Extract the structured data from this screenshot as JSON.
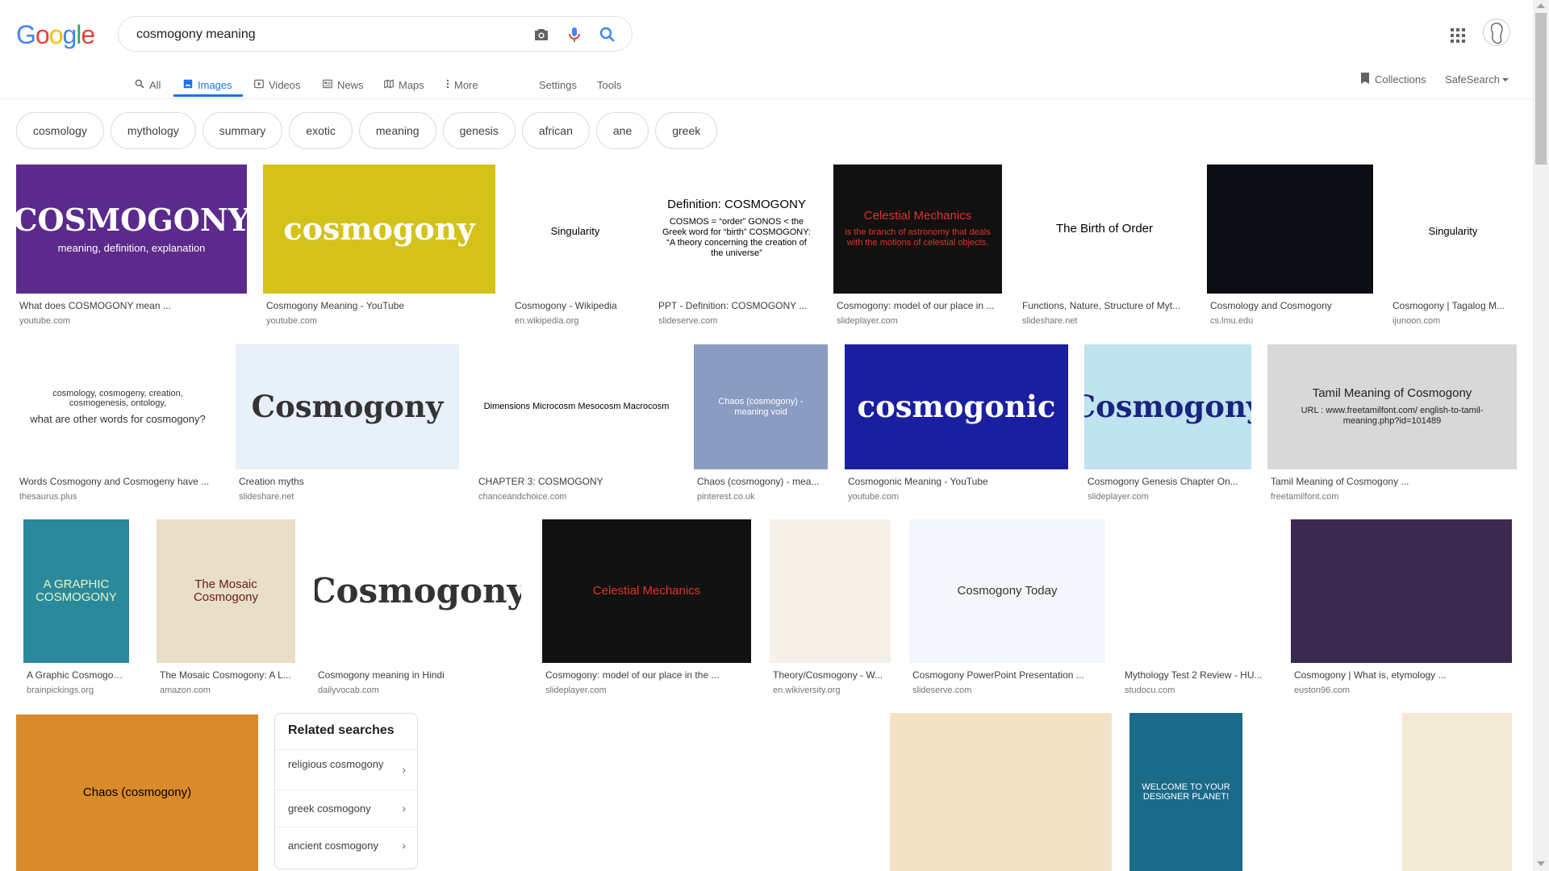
{
  "logo": {
    "letters": [
      "G",
      "o",
      "o",
      "g",
      "l",
      "e"
    ],
    "colors": [
      "#4285F4",
      "#EA4335",
      "#FBBC05",
      "#4285F4",
      "#34A853",
      "#EA4335"
    ]
  },
  "search": {
    "query": "cosmogony meaning"
  },
  "tabs": [
    {
      "label": "All",
      "icon": "search-icon"
    },
    {
      "label": "Images",
      "icon": "image-icon",
      "active": true
    },
    {
      "label": "Videos",
      "icon": "video-icon"
    },
    {
      "label": "News",
      "icon": "news-icon"
    },
    {
      "label": "Maps",
      "icon": "map-icon"
    },
    {
      "label": "More",
      "icon": "more-vert-icon"
    },
    {
      "label": "Settings"
    },
    {
      "label": "Tools"
    }
  ],
  "header_right": {
    "collections": "Collections",
    "safesearch": "SafeSearch"
  },
  "chips": [
    "cosmology",
    "mythology",
    "summary",
    "exotic",
    "meaning",
    "genesis",
    "african",
    "ane",
    "greek"
  ],
  "images": [
    {
      "title": "What does COSMOGONY mean ...",
      "source": "youtube.com",
      "bg": "#5b2a8c",
      "fg": "#ffffff",
      "text": "COSMOGONY",
      "sub": "meaning, definition, explanation"
    },
    {
      "title": "Cosmogony Meaning - YouTube",
      "source": "youtube.com",
      "bg": "#d4c21a",
      "fg": "#ffffff",
      "text": "cosmogony",
      "sub": ""
    },
    {
      "title": "Cosmogony - Wikipedia",
      "source": "en.wikipedia.org",
      "bg": "#ffffff",
      "fg": "#000000",
      "text": "",
      "sub": "Singularity"
    },
    {
      "title": "PPT - Definition: COSMOGONY ...",
      "source": "slideserve.com",
      "bg": "#ffffff",
      "fg": "#000000",
      "text": "Definition: COSMOGONY",
      "sub": "COSMOS = “order” GONOS < the Greek word for “birth” COSMOGONY: “A theory concerning the creation of the universe”"
    },
    {
      "title": "Cosmogony: model of our place in ...",
      "source": "slideplayer.com",
      "bg": "#111111",
      "fg": "#e0332b",
      "text": "Celestial Mechanics",
      "sub": "is the branch of astronomy that deals with the motions of celestial objects."
    },
    {
      "title": "Functions, Nature, Structure of Myt...",
      "source": "slideshare.net",
      "bg": "#ffffff",
      "fg": "#000000",
      "text": "The Birth of Order",
      "sub": ""
    },
    {
      "title": "Cosmology and Cosmogony",
      "source": "cs.lmu.edu",
      "bg": "#0c0c14",
      "fg": "#cfe3ff",
      "text": "",
      "sub": ""
    },
    {
      "title": "Cosmogony | Tagalog M...",
      "source": "ijunoon.com",
      "bg": "#ffffff",
      "fg": "#000000",
      "text": "",
      "sub": "Singularity"
    },
    {
      "title": "Words Cosmogony and Cosmogeny have ...",
      "source": "thesaurus.plus",
      "bg": "#ffffff",
      "fg": "#333333",
      "text": "cosmology, cosmogeny, creation, cosmogenesis, ontology,",
      "sub": "what are other words for cosmogony?"
    },
    {
      "title": "Creation myths",
      "source": "slideshare.net",
      "bg": "#e8f0fa",
      "fg": "#333333",
      "text": "Cosmogony",
      "sub": ""
    },
    {
      "title": "CHAPTER 3: COSMOGONY",
      "source": "chanceandchoice.com",
      "bg": "#ffffff",
      "fg": "#000000",
      "text": "Dimensions  Microcosm  Mesocosm  Macrocosm",
      "sub": ""
    },
    {
      "title": "Chaos (cosmogony) - mea...",
      "source": "pinterest.co.uk",
      "bg": "#8a9cc2",
      "fg": "#ffffff",
      "text": "Chaos (cosmogony) - meaning void",
      "sub": ""
    },
    {
      "title": "Cosmogonic Meaning - YouTube",
      "source": "youtube.com",
      "bg": "#1a1fa0",
      "fg": "#ffffff",
      "text": "cosmogonic",
      "sub": ""
    },
    {
      "title": "Cosmogony Genesis Chapter On...",
      "source": "slideplayer.com",
      "bg": "#bfe3ef",
      "fg": "#1a237e",
      "text": "Cosmogony",
      "sub": ""
    },
    {
      "title": "Tamil Meaning of Cosmogony ...",
      "source": "freetamilfont.com",
      "bg": "#d8d8d8",
      "fg": "#222222",
      "text": "Tamil Meaning of Cosmogony",
      "sub": "URL : www.freetamilfont.com/ english-to-tamil-meaning.php?id=101489"
    },
    {
      "title": "A Graphic Cosmogony: ...",
      "source": "brainpickings.org",
      "bg": "#2a8a9c",
      "fg": "#e8f5c8",
      "text": "A GRAPHIC COSMOGONY",
      "sub": ""
    },
    {
      "title": "The Mosaic Cosmogony: A L...",
      "source": "amazon.com",
      "bg": "#e9dfc9",
      "fg": "#6b1a1a",
      "text": "The Mosaic Cosmogony",
      "sub": ""
    },
    {
      "title": "Cosmogony meaning in Hindi",
      "source": "dailyvocab.com",
      "bg": "#ffffff",
      "fg": "#333333",
      "text": "Cosmogony",
      "sub": ""
    },
    {
      "title": "Cosmogony: model of our place in the ...",
      "source": "slideplayer.com",
      "bg": "#111111",
      "fg": "#e0332b",
      "text": "Celestial Mechanics",
      "sub": ""
    },
    {
      "title": "Theory/Cosmogony - W...",
      "source": "en.wikiversity.org",
      "bg": "#f5f0e8",
      "fg": "#000000",
      "text": "",
      "sub": ""
    },
    {
      "title": "Cosmogony PowerPoint Presentation ...",
      "source": "slideserve.com",
      "bg": "#f3f6fa",
      "fg": "#333333",
      "text": "Cosmogony Today",
      "sub": ""
    },
    {
      "title": "Mythology Test 2 Review - HU...",
      "source": "studocu.com",
      "bg": "#ffffff",
      "fg": "#333333",
      "text": "",
      "sub": ""
    },
    {
      "title": "Cosmogony | What is, etymology ...",
      "source": "euston96.com",
      "bg": "#3a2a50",
      "fg": "#ffffff",
      "text": "",
      "sub": ""
    },
    {
      "title": "",
      "source": "",
      "bg": "#d98a2a",
      "fg": "#000000",
      "text": "Chaos (cosmogony)",
      "sub": ""
    },
    {
      "title": "",
      "source": "",
      "bg": "#ffffff",
      "fg": "#333333",
      "text": "",
      "sub": ""
    },
    {
      "title": "",
      "source": "",
      "bg": "#ffffff",
      "fg": "#333333",
      "text": "",
      "sub": ""
    },
    {
      "title": "",
      "source": "",
      "bg": "#f3e3c6",
      "fg": "#333333",
      "text": "",
      "sub": ""
    },
    {
      "title": "",
      "source": "",
      "bg": "#1a6a8a",
      "fg": "#ffffff",
      "text": "WELCOME TO YOUR DESIGNER PLANET!",
      "sub": ""
    },
    {
      "title": "",
      "source": "",
      "bg": "#ffffff",
      "fg": "#333333",
      "text": "",
      "sub": ""
    },
    {
      "title": "",
      "source": "",
      "bg": "#f3ead6",
      "fg": "#333333",
      "text": "",
      "sub": ""
    }
  ],
  "related": {
    "title": "Related searches",
    "items": [
      "religious cosmogony",
      "greek cosmogony",
      "ancient cosmogony"
    ]
  }
}
